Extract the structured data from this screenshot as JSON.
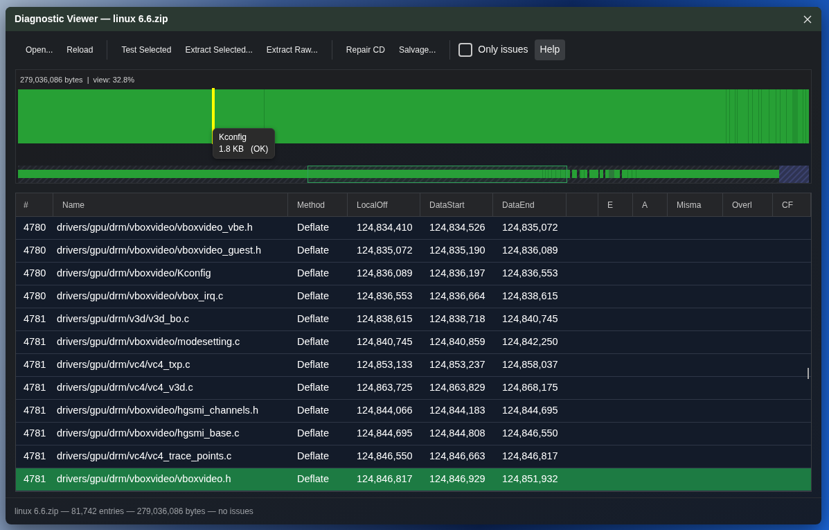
{
  "window": {
    "title": "Diagnostic Viewer — linux 6.6.zip"
  },
  "toolbar": {
    "groups": [
      [
        "Open...",
        "Reload"
      ],
      [
        "Test Selected",
        "Extract Selected...",
        "Extract Raw..."
      ],
      [
        "Repair CD",
        "Salvage..."
      ]
    ],
    "only_issues": {
      "label": "Only issues",
      "checked": false
    },
    "help_button": "Help"
  },
  "byte_map": {
    "summary": "279,036,086 bytes  |  view: 32.8%",
    "tooltip": {
      "name": "Kconfig",
      "size": "1.8 KB",
      "status": "(OK)"
    }
  },
  "table": {
    "columns": [
      {
        "label": "#"
      },
      {
        "label": "Name"
      },
      {
        "label": "Method"
      },
      {
        "label": "LocalOff"
      },
      {
        "label": "DataStart"
      },
      {
        "label": "DataEnd"
      },
      {},
      {
        "label": "E"
      },
      {
        "label": "A"
      },
      {
        "label": "Misma"
      },
      {
        "label": "Overl"
      },
      {
        "label": "CF"
      }
    ],
    "rows": [
      {
        "cells": [
          "4780",
          "drivers/gpu/drm/vboxvideo/vboxvideo_vbe.h",
          "Deflate",
          "124,834,410",
          "124,834,526",
          "124,835,072"
        ],
        "selected": false
      },
      {
        "cells": [
          "4780",
          "drivers/gpu/drm/vboxvideo/vboxvideo_guest.h",
          "Deflate",
          "124,835,072",
          "124,835,190",
          "124,836,089"
        ],
        "selected": false
      },
      {
        "cells": [
          "4780",
          "drivers/gpu/drm/vboxvideo/Kconfig",
          "Deflate",
          "124,836,089",
          "124,836,197",
          "124,836,553"
        ],
        "selected": false
      },
      {
        "cells": [
          "4780",
          "drivers/gpu/drm/vboxvideo/vbox_irq.c",
          "Deflate",
          "124,836,553",
          "124,836,664",
          "124,838,615"
        ],
        "selected": false
      },
      {
        "cells": [
          "4781",
          "drivers/gpu/drm/v3d/v3d_bo.c",
          "Deflate",
          "124,838,615",
          "124,838,718",
          "124,840,745"
        ],
        "selected": false
      },
      {
        "cells": [
          "4781",
          "drivers/gpu/drm/vboxvideo/modesetting.c",
          "Deflate",
          "124,840,745",
          "124,840,859",
          "124,842,250"
        ],
        "selected": false
      },
      {
        "cells": [
          "4781",
          "drivers/gpu/drm/vc4/vc4_txp.c",
          "Deflate",
          "124,853,133",
          "124,853,237",
          "124,858,037"
        ],
        "selected": false
      },
      {
        "cells": [
          "4781",
          "drivers/gpu/drm/vc4/vc4_v3d.c",
          "Deflate",
          "124,863,725",
          "124,863,829",
          "124,868,175"
        ],
        "selected": false
      },
      {
        "cells": [
          "4781",
          "drivers/gpu/drm/vboxvideo/hgsmi_channels.h",
          "Deflate",
          "124,844,066",
          "124,844,183",
          "124,844,695"
        ],
        "selected": false
      },
      {
        "cells": [
          "4781",
          "drivers/gpu/drm/vboxvideo/hgsmi_base.c",
          "Deflate",
          "124,844,695",
          "124,844,808",
          "124,846,550"
        ],
        "selected": false
      },
      {
        "cells": [
          "4781",
          "drivers/gpu/drm/vc4/vc4_trace_points.c",
          "Deflate",
          "124,846,550",
          "124,846,663",
          "124,846,817"
        ],
        "selected": false
      },
      {
        "cells": [
          "4781",
          "drivers/gpu/drm/vboxvideo/vboxvideo.h",
          "Deflate",
          "124,846,817",
          "124,846,929",
          "124,851,932"
        ],
        "selected": true
      }
    ]
  },
  "status_bar": "linux 6.6.zip — 81,742 entries — 279,036,086 bytes — no issues"
}
